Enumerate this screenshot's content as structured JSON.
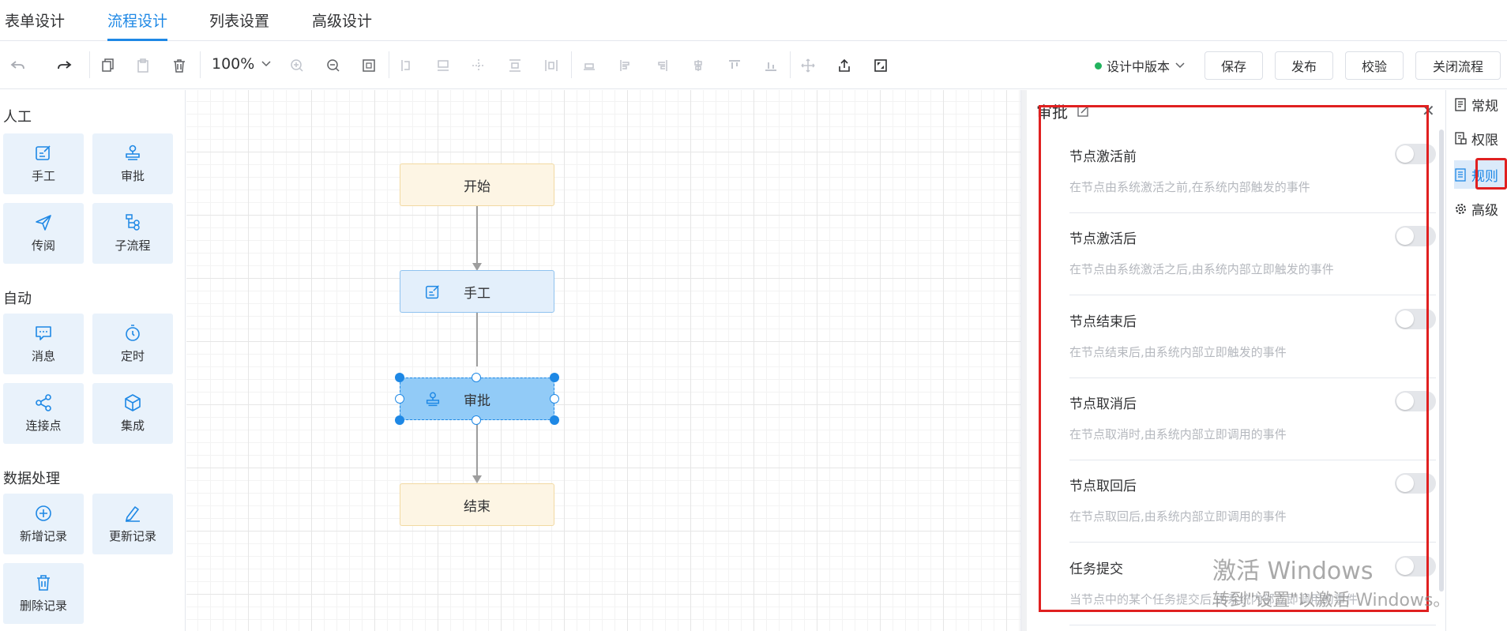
{
  "tabs": [
    {
      "label": "表单设计",
      "active": false
    },
    {
      "label": "流程设计",
      "active": true
    },
    {
      "label": "列表设置",
      "active": false
    },
    {
      "label": "高级设计",
      "active": false
    }
  ],
  "toolbar": {
    "zoom": "100%",
    "version_label": "设计中版本",
    "save": "保存",
    "publish": "发布",
    "validate": "校验",
    "close_flow": "关闭流程"
  },
  "palette": {
    "groups": [
      {
        "title": "人工",
        "items": [
          {
            "label": "手工",
            "icon": "edit-form-icon"
          },
          {
            "label": "审批",
            "icon": "stamp-icon"
          },
          {
            "label": "传阅",
            "icon": "send-icon"
          },
          {
            "label": "子流程",
            "icon": "subprocess-icon"
          }
        ]
      },
      {
        "title": "自动",
        "items": [
          {
            "label": "消息",
            "icon": "message-icon"
          },
          {
            "label": "定时",
            "icon": "timer-icon"
          },
          {
            "label": "连接点",
            "icon": "share-icon"
          },
          {
            "label": "集成",
            "icon": "cube-icon"
          }
        ]
      },
      {
        "title": "数据处理",
        "items": [
          {
            "label": "新增记录",
            "icon": "plus-circle-icon"
          },
          {
            "label": "更新记录",
            "icon": "pen-icon"
          },
          {
            "label": "删除记录",
            "icon": "trash-icon"
          }
        ]
      }
    ]
  },
  "flow": {
    "nodes": [
      {
        "label": "开始",
        "type": "start"
      },
      {
        "label": "手工",
        "type": "manual"
      },
      {
        "label": "审批",
        "type": "approve",
        "selected": true
      },
      {
        "label": "结束",
        "type": "end"
      }
    ]
  },
  "panel": {
    "title": "审批",
    "rules": [
      {
        "label": "节点激活前",
        "desc": "在节点由系统激活之前,在系统内部触发的事件",
        "enabled": false
      },
      {
        "label": "节点激活后",
        "desc": "在节点由系统激活之后,由系统内部立即触发的事件",
        "enabled": false
      },
      {
        "label": "节点结束后",
        "desc": "在节点结束后,由系统内部立即触发的事件",
        "enabled": false
      },
      {
        "label": "节点取消后",
        "desc": "在节点取消时,由系统内部立即调用的事件",
        "enabled": false
      },
      {
        "label": "节点取回后",
        "desc": "在节点取回后,由系统内部立即调用的事件",
        "enabled": false
      },
      {
        "label": "任务提交",
        "desc": "当节点中的某个任务提交后,由系统内部立即调用的事件",
        "enabled": false
      }
    ]
  },
  "side_tabs": [
    {
      "label": "常规",
      "icon": "document-icon",
      "active": false
    },
    {
      "label": "权限",
      "icon": "permission-icon",
      "active": false
    },
    {
      "label": "规则",
      "icon": "rules-icon",
      "active": true
    },
    {
      "label": "高级",
      "icon": "advanced-gear-icon",
      "active": false
    }
  ],
  "watermark": {
    "line1": "激活 Windows",
    "line2": "转到\"设置\"以激活 Windows。"
  },
  "colors": {
    "accent": "#1e88e5",
    "highlight": "#e02020",
    "status_green": "#22b35e"
  }
}
